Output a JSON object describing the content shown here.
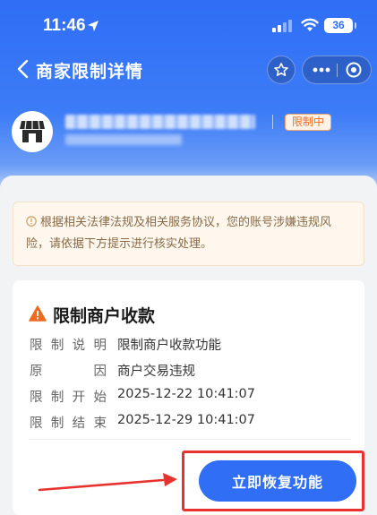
{
  "status_bar": {
    "time": "11:46",
    "battery": "36"
  },
  "nav": {
    "title": "商家限制详情"
  },
  "merchant": {
    "status_tag": "限制中"
  },
  "notice": {
    "text": "根据相关法律法规及相关服务协议，您的账号涉嫌违规风险，请依据下方提示进行核实处理。"
  },
  "card": {
    "title": "限制商户收款",
    "rows": [
      {
        "label_chars": [
          "限",
          "制",
          "说",
          "明"
        ],
        "value": "限制商户收款功能"
      },
      {
        "label_chars": [
          "原",
          "因"
        ],
        "value": "商户交易违规"
      },
      {
        "label_chars": [
          "限",
          "制",
          "开",
          "始"
        ],
        "value": "2025-12-22 10:41:07"
      },
      {
        "label_chars": [
          "限",
          "制",
          "结",
          "束"
        ],
        "value": "2025-12-29 10:41:07"
      }
    ],
    "action_label": "立即恢复功能"
  },
  "colors": {
    "brand_blue": "#2f6ef5",
    "tag_orange": "#f06a1f",
    "warning_orange": "#f06a1f",
    "highlight_red": "#e8322d"
  }
}
